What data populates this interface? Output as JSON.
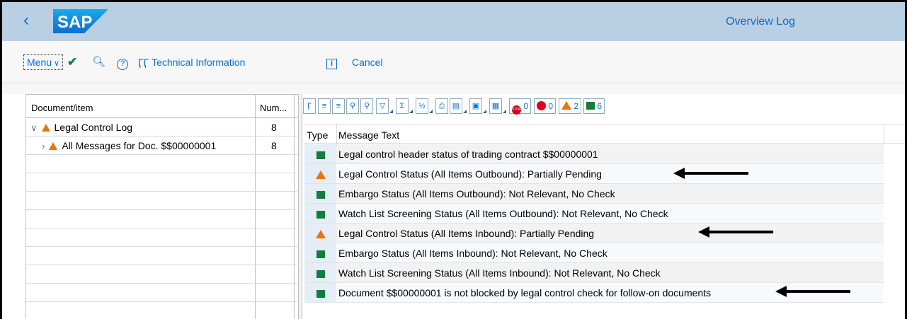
{
  "shell": {
    "logo_text": "SAP",
    "title": "Overview Log",
    "brand_color": "#0a6ed1",
    "header_bg": "#b9cfe3"
  },
  "toolbar": {
    "menu_label": "Menu",
    "technical_information_label": "Technical Information",
    "cancel_label": "Cancel"
  },
  "tree": {
    "columns": [
      "Document/item",
      "Num..."
    ],
    "rows": [
      {
        "label": "Legal Control Log",
        "count": "8",
        "expander": "expanded"
      },
      {
        "label": "All Messages for Doc. $$00000001",
        "count": "8",
        "expander": "collapsed"
      }
    ]
  },
  "alv_toolbar": {
    "stop_count": "0",
    "error_count": "0",
    "warning_count": "2",
    "success_count": "6"
  },
  "messages": {
    "columns": [
      "Type",
      "Message Text"
    ],
    "rows": [
      {
        "type": "success",
        "text": "Legal control header status of trading contract $$00000001"
      },
      {
        "type": "warning",
        "text": "Legal Control Status (All Items Outbound): Partially Pending"
      },
      {
        "type": "success",
        "text": "Embargo Status (All Items Outbound): Not Relevant, No Check"
      },
      {
        "type": "success",
        "text": "Watch List Screening Status (All Items Outbound): Not Relevant, No Check"
      },
      {
        "type": "warning",
        "text": "Legal Control Status (All Items Inbound): Partially Pending"
      },
      {
        "type": "success",
        "text": "Embargo Status (All Items Inbound): Not Relevant, No Check"
      },
      {
        "type": "success",
        "text": "Watch List Screening Status (All Items Inbound): Not Relevant, No Check"
      },
      {
        "type": "success",
        "text": "Document $$00000001 is not blocked by legal control check for follow-on documents"
      }
    ]
  }
}
